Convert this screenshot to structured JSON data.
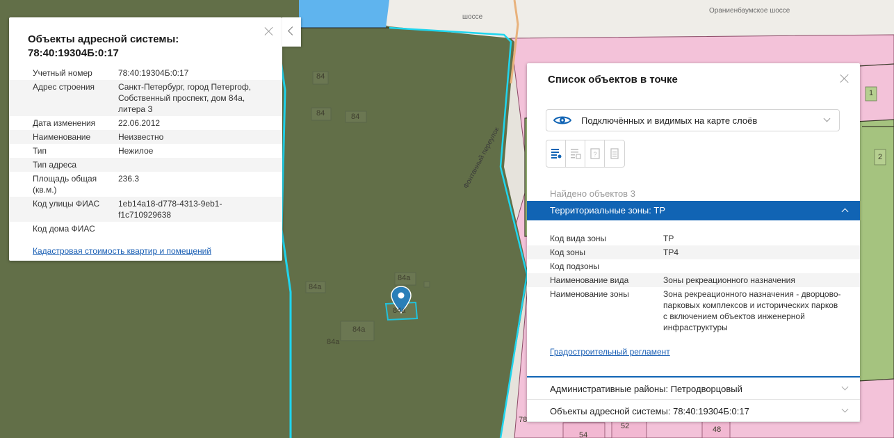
{
  "map": {
    "road_labels": {
      "shosse": "шоссе",
      "oranienbaum": "Ораниенбаумское шоссе",
      "lane": "Фонтанный переулок"
    },
    "building_labels": {
      "b84_1": "84",
      "b84_2": "84",
      "b84_3": "84",
      "b84a_1": "84а",
      "b84a_2": "84а",
      "b84a_3": "84а",
      "b84a_4": "84а",
      "b84a_5": "84а",
      "b1": "1",
      "b2": "2",
      "b78": "78",
      "b52": "52",
      "b54": "54",
      "b48": "48"
    },
    "colors": {
      "green_zone": "#62704a",
      "pink_zone": "#f4c6dc",
      "light_green": "#a7c382",
      "water_blue": "#62b3ec",
      "boundary_cyan": "#22d4ee",
      "marker": "#2a7fb8"
    }
  },
  "left_popup": {
    "title": "Объекты адресной системы: 78:40:19304Б:0:17",
    "collapse_icon": "chevron-left-icon",
    "rows": [
      {
        "key": "Учетный номер",
        "value": "78:40:19304Б:0:17"
      },
      {
        "key": "Адрес строения",
        "value": "Санкт-Петербург, город Петергоф, Собственный проспект, дом 84а, литера З"
      },
      {
        "key": "Дата изменения",
        "value": "22.06.2012"
      },
      {
        "key": "Наименование",
        "value": "Неизвестно"
      },
      {
        "key": "Тип",
        "value": "Нежилое"
      },
      {
        "key": "Тип адреса",
        "value": ""
      },
      {
        "key": "Площадь общая (кв.м.)",
        "value": "236.3"
      },
      {
        "key": "Код улицы ФИАС",
        "value": "1eb14a18-d778-4313-9eb1-f1c710929638"
      },
      {
        "key": "Код дома ФИАС",
        "value": ""
      }
    ],
    "link": "Кадастровая стоимость квартир и помещений"
  },
  "right_panel": {
    "title": "Список объектов в точке",
    "layer_select": {
      "selected": "Подключённых и видимых на карте слоёв",
      "icon": "eye-icon"
    },
    "view_buttons": [
      "list-marker-icon",
      "list-table-icon",
      "help-icon",
      "document-icon"
    ],
    "found_text": "Найдено объектов 3",
    "zone_header": "Территориальные зоны: ТР",
    "zone_rows": [
      {
        "key": "Код вида зоны",
        "value": "ТР"
      },
      {
        "key": "Код зоны",
        "value": "ТР4"
      },
      {
        "key": "Код подзоны",
        "value": ""
      },
      {
        "key": "Наименование вида",
        "value": "Зоны рекреационного назначения"
      },
      {
        "key": "Наименование зоны",
        "value": "Зона рекреационного назначения - дворцово-парковых комплексов и исторических парков с включением объектов инженерной инфраструктуры"
      }
    ],
    "zone_link": "Градостроительный регламент",
    "accordion": [
      {
        "label": "Административные районы: Петродворцовый"
      },
      {
        "label": "Объекты адресной системы: 78:40:19304Б:0:17"
      }
    ]
  }
}
